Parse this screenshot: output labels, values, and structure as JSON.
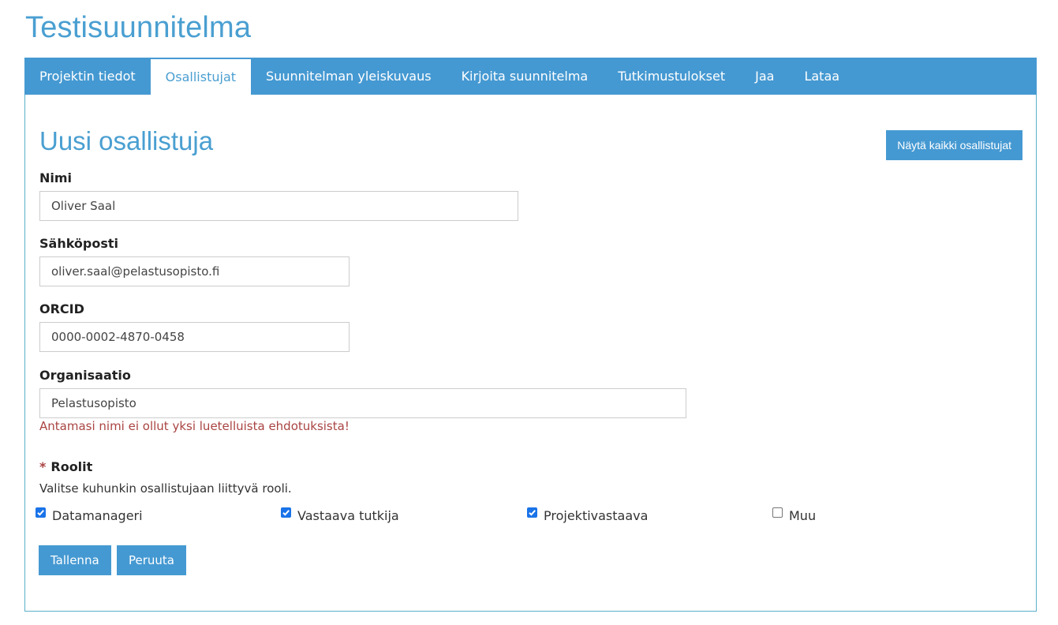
{
  "page_title": "Testisuunnitelma",
  "tabs": [
    {
      "label": "Projektin tiedot",
      "active": false
    },
    {
      "label": "Osallistujat",
      "active": true
    },
    {
      "label": "Suunnitelman yleiskuvaus",
      "active": false
    },
    {
      "label": "Kirjoita suunnitelma",
      "active": false
    },
    {
      "label": "Tutkimustulokset",
      "active": false
    },
    {
      "label": "Jaa",
      "active": false
    },
    {
      "label": "Lataa",
      "active": false
    }
  ],
  "form": {
    "title": "Uusi osallistuja",
    "show_all_label": "Näytä kaikki osallistujat",
    "name": {
      "label": "Nimi",
      "value": "Oliver Saal"
    },
    "email": {
      "label": "Sähköposti",
      "value": "oliver.saal@pelastusopisto.fi"
    },
    "orcid": {
      "label": "ORCID",
      "value": "0000-0002-4870-0458"
    },
    "organisation": {
      "label": "Organisaatio",
      "value": "Pelastusopisto",
      "error": "Antamasi nimi ei ollut yksi luetelluista ehdotuksista!"
    },
    "roles": {
      "required_marker": "*",
      "label": "Roolit",
      "help": "Valitse kuhunkin osallistujaan liittyvä rooli.",
      "options": [
        {
          "label": "Datamanageri",
          "checked": true
        },
        {
          "label": "Vastaava tutkija",
          "checked": true
        },
        {
          "label": "Projektivastaava",
          "checked": true
        },
        {
          "label": "Muu",
          "checked": false
        }
      ]
    },
    "save_label": "Tallenna",
    "cancel_label": "Peruuta"
  },
  "colors": {
    "accent": "#4599d2",
    "title": "#4a9fd1",
    "error": "#a94442",
    "checkbox": "#1a73e8"
  }
}
